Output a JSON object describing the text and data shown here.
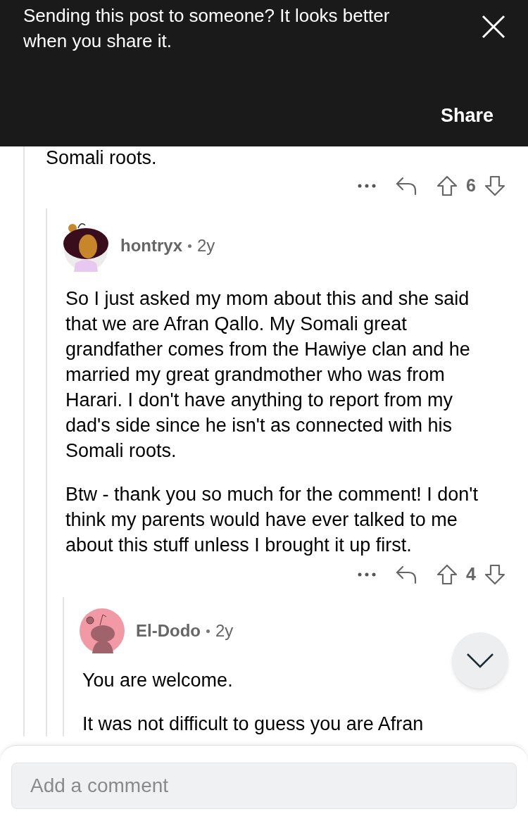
{
  "banner": {
    "message": "Sending this post to someone? It looks better when you share it.",
    "share_label": "Share"
  },
  "previous_comment": {
    "text_tail": "Somali roots.",
    "votes": "6"
  },
  "comments": [
    {
      "author": "hontryx",
      "age": "2y",
      "kind": "custom",
      "paragraphs": [
        "So I just asked my mom about this and she said that we are Afran Qallo. My Somali great grandfather comes from the Hawiye clan and he married my great grandmother who was from Harari. I don't have anything to report from my dad's side since he isn't as connected with his Somali roots.",
        "Btw - thank you so much for the comment! I don't think my parents would have ever talked to me about this stuff unless I brought it up first."
      ],
      "votes": "4",
      "children": [
        {
          "author": "El-Dodo",
          "age": "2y",
          "kind": "default",
          "paragraphs": [
            "You are welcome.",
            "It was not difficult to guess you are Afran"
          ]
        }
      ]
    }
  ],
  "composer": {
    "placeholder": "Add a comment"
  }
}
